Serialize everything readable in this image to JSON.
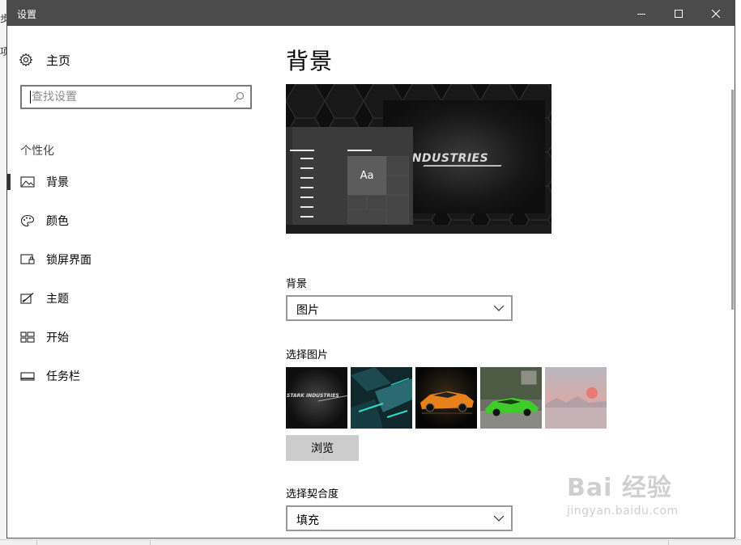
{
  "window": {
    "title": "设置"
  },
  "behind_window": {
    "chars": [
      "步",
      "项"
    ]
  },
  "sidebar": {
    "home": {
      "label": "主页",
      "icon": "gear-icon"
    },
    "search": {
      "placeholder": "查找设置",
      "value": ""
    },
    "section_title": "个性化",
    "items": [
      {
        "label": "背景",
        "icon": "picture-icon",
        "selected": true
      },
      {
        "label": "颜色",
        "icon": "palette-icon",
        "selected": false
      },
      {
        "label": "锁屏界面",
        "icon": "lock-screen-icon",
        "selected": false
      },
      {
        "label": "主题",
        "icon": "theme-brush-icon",
        "selected": false
      },
      {
        "label": "开始",
        "icon": "start-tiles-icon",
        "selected": false
      },
      {
        "label": "任务栏",
        "icon": "taskbar-icon",
        "selected": false
      }
    ]
  },
  "main": {
    "title": "背景",
    "preview": {
      "tile_text": "Aa",
      "wallpaper_text": "INDUSTRIES"
    },
    "background": {
      "label": "背景",
      "value": "图片"
    },
    "choose_picture": {
      "label": "选择图片",
      "thumbnails": [
        {
          "name": "stark-industries",
          "caption": "STARK INDUSTRIES"
        },
        {
          "name": "teal-abstract"
        },
        {
          "name": "orange-supercar"
        },
        {
          "name": "green-sportscar"
        },
        {
          "name": "pink-sunset"
        }
      ],
      "browse_label": "浏览"
    },
    "fit": {
      "label": "选择契合度",
      "value": "填充"
    }
  },
  "watermark": {
    "line1": "Bai 经验",
    "line2": "jingyan.baidu.com"
  }
}
